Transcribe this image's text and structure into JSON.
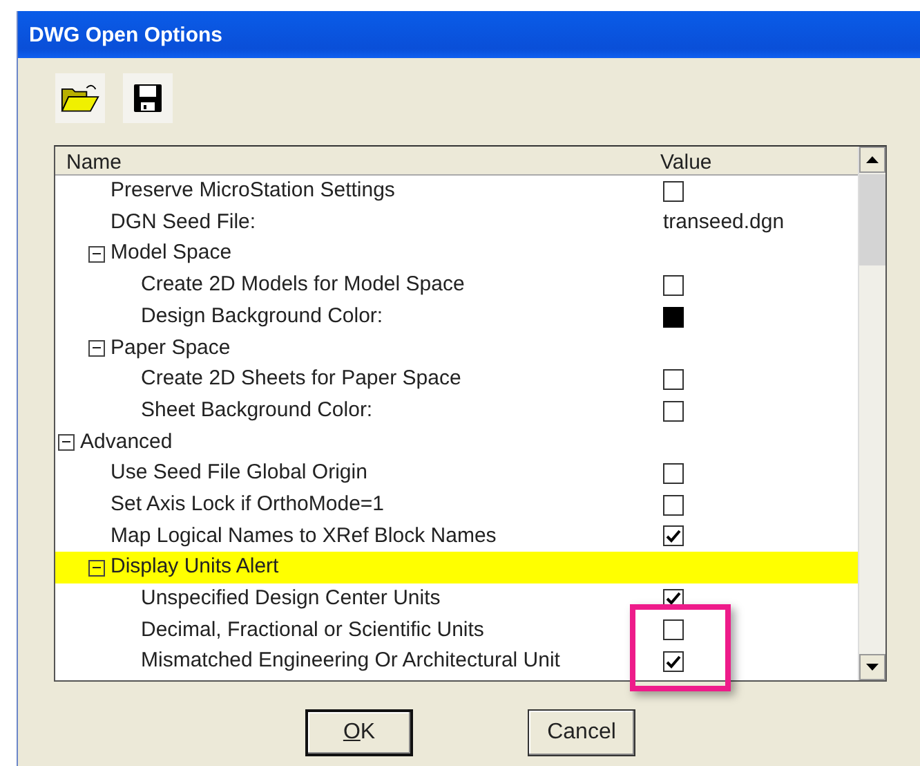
{
  "window": {
    "title": "DWG Open Options"
  },
  "table": {
    "columns": [
      "Name",
      "Value"
    ],
    "rows": [
      {
        "kind": "continued",
        "children": [
          {
            "label": "Preserve MicroStation Settings",
            "kind": "checkbox",
            "checked": false,
            "selected": false
          },
          {
            "label": "DGN Seed File:",
            "kind": "text",
            "value": "transeed.dgn",
            "selected": false
          },
          {
            "label": "Model Space",
            "kind": "group",
            "expanded": true,
            "selected": false,
            "children": [
              {
                "label": "Create 2D Models for Model Space",
                "kind": "checkbox",
                "checked": false,
                "selected": false
              },
              {
                "label": "Design Background Color:",
                "kind": "color",
                "color": "#000000",
                "selected": false
              }
            ]
          },
          {
            "label": "Paper Space",
            "kind": "group",
            "expanded": true,
            "selected": false,
            "children": [
              {
                "label": "Create 2D Sheets for Paper Space",
                "kind": "checkbox",
                "checked": false,
                "selected": false
              },
              {
                "label": "Sheet Background Color:",
                "kind": "checkbox",
                "checked": false,
                "selected": false
              }
            ]
          }
        ]
      },
      {
        "label": "Advanced",
        "kind": "group",
        "expanded": true,
        "selected": false,
        "children": [
          {
            "label": "Use Seed File Global Origin",
            "kind": "checkbox",
            "checked": false,
            "selected": false
          },
          {
            "label": "Set Axis Lock if OrthoMode=1",
            "kind": "checkbox",
            "checked": false,
            "selected": false
          },
          {
            "label": "Map Logical Names to XRef Block Names",
            "kind": "checkbox",
            "checked": true,
            "selected": false
          },
          {
            "label": "Display Units Alert",
            "kind": "group",
            "expanded": true,
            "selected": true,
            "children": [
              {
                "label": "Unspecified Design Center Units",
                "kind": "checkbox",
                "checked": true,
                "selected": false
              },
              {
                "label": "Decimal, Fractional or Scientific Units",
                "kind": "checkbox",
                "checked": false,
                "selected": false
              },
              {
                "label": "Mismatched Engineering Or Architectural Unit",
                "kind": "checkbox",
                "checked": true,
                "selected": false
              }
            ]
          }
        ]
      }
    ]
  },
  "buttons": [
    {
      "label": "OK",
      "default": true
    },
    {
      "label": "Cancel",
      "default": false
    }
  ]
}
